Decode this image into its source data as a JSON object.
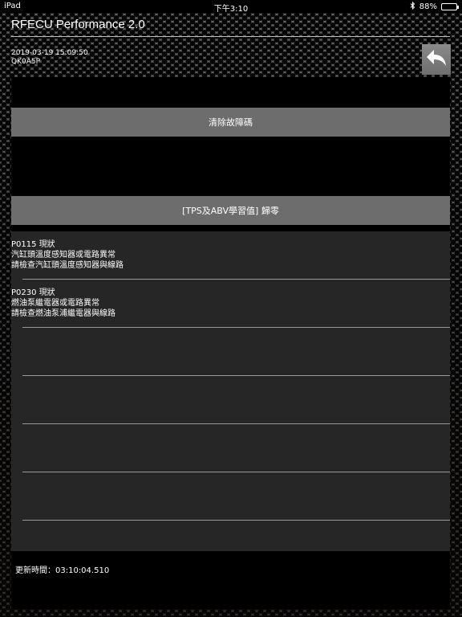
{
  "status": {
    "device": "iPad",
    "time": "下午3:10",
    "battery": "88%"
  },
  "header": {
    "title": "RFECU Performance 2.0",
    "datetime": "2019-03-19 15:09:50",
    "code": "QK0A5P"
  },
  "buttons": {
    "clear_codes": "清除故障碼",
    "reset_tps": "[TPS及ABV學習值] 歸零"
  },
  "faults": [
    {
      "code_status": "P0115 現狀",
      "description": "汽缸頭溫度感知器或電路異常",
      "advice": "請檢查汽缸頭溫度感知器與線路"
    },
    {
      "code_status": "P0230 現狀",
      "description": "燃油泵繼電器或電路異常",
      "advice": "請檢查燃油泵浦繼電器與線路"
    }
  ],
  "footer": {
    "update_time": "更新時間：03:10:04.510"
  }
}
